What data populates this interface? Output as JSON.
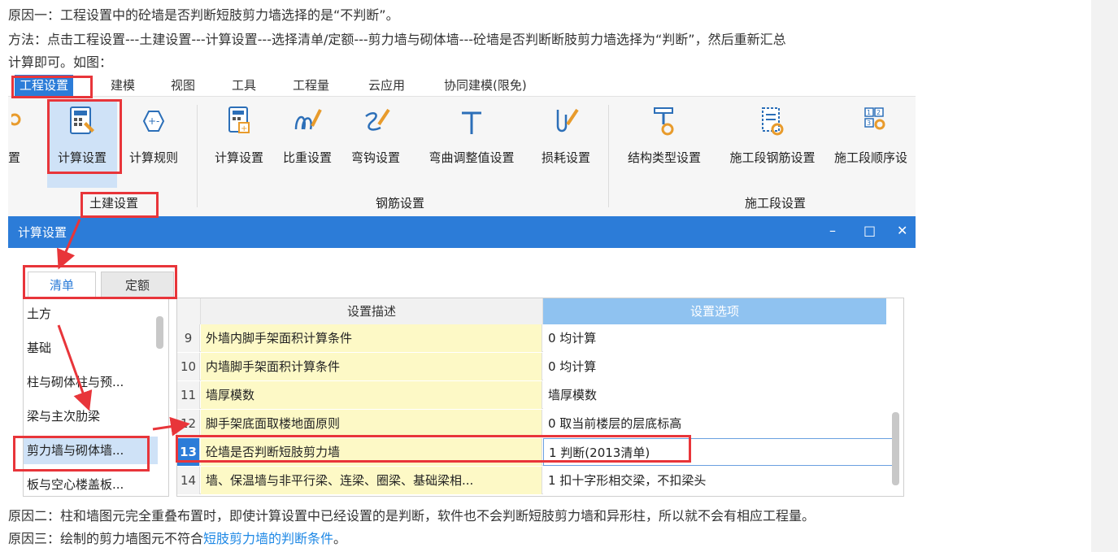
{
  "text": {
    "line1": "原因一：工程设置中的砼墙是否判断短肢剪力墙选择的是“不判断”。",
    "line2": "方法：点击工程设置---土建设置---计算设置---选择清单/定额---剪力墙与砌体墙---砼墙是否判断断肢剪力墙选择为“判断”，然后重新汇总",
    "line3": "计算即可。如图：",
    "line4": "原因二：柱和墙图元完全重叠布置时，即使计算设置中已经设置的是判断，软件也不会判断短肢剪力墙和异形柱，所以就不会有相应工程量。",
    "line5_prefix": "原因三：绘制的剪力墙图元不符合",
    "line5_link": "短肢剪力墙的判断条件",
    "line5_suffix": "。"
  },
  "ribbon": {
    "tabs": [
      "工程设置",
      "建模",
      "视图",
      "工具",
      "工程量",
      "云应用",
      "协同建模(限免)"
    ],
    "buttons": {
      "partial": "置",
      "calc_settings": "计算设置",
      "calc_rules": "计算规则",
      "rebar_calc": "计算设置",
      "weight": "比重设置",
      "hook": "弯钩设置",
      "bend": "弯曲调整值设置",
      "loss": "损耗设置",
      "struct_type": "结构类型设置",
      "stage_rebar": "施工段钢筋设置",
      "stage_order": "施工段顺序设"
    },
    "groups": {
      "civil": "土建设置",
      "rebar": "钢筋设置",
      "stage": "施工段设置"
    }
  },
  "dialog": {
    "title": "计算设置",
    "controls": {
      "minimize": "–",
      "maximize": "□",
      "close": "✕"
    },
    "subtabs": [
      "清单",
      "定额"
    ],
    "categories": [
      "土方",
      "基础",
      "柱与砌体柱与预...",
      "梁与主次肋梁",
      "剪力墙与砌体墙...",
      "板与空心楼盖板..."
    ],
    "grid_headers": {
      "desc": "设置描述",
      "option": "设置选项"
    },
    "rows": [
      {
        "num": "9",
        "desc": "外墙内脚手架面积计算条件",
        "option": "0 均计算"
      },
      {
        "num": "10",
        "desc": "内墙脚手架面积计算条件",
        "option": "0 均计算"
      },
      {
        "num": "11",
        "desc": "墙厚模数",
        "option": "墙厚模数"
      },
      {
        "num": "12",
        "desc": "脚手架底面取楼地面原则",
        "option": "0 取当前楼层的层底标高"
      },
      {
        "num": "13",
        "desc": "砼墙是否判断短肢剪力墙",
        "option": "1 判断(2013清单)"
      },
      {
        "num": "14",
        "desc": "墙、保温墙与非平行梁、连梁、圈梁、基础梁相...",
        "option": "1 扣十字形相交梁，不扣梁头"
      }
    ]
  },
  "colors": {
    "accent": "#2c7cd8",
    "highlight_red": "#e8353a",
    "desc_bg": "#fdf9c6",
    "link": "#1e88e5"
  }
}
